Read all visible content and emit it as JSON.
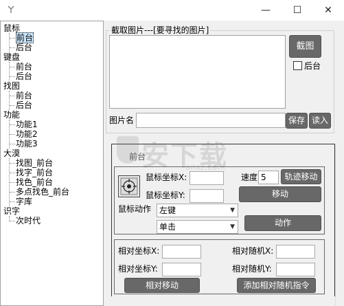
{
  "titlebar": {
    "minimize_glyph": "—",
    "maximize_glyph": "☐",
    "close_glyph": "✕"
  },
  "tree": {
    "groups": [
      {
        "label": "鼠标",
        "children": [
          "前台",
          "后台"
        ]
      },
      {
        "label": "键盘",
        "children": [
          "前台",
          "后台"
        ]
      },
      {
        "label": "找图",
        "children": [
          "前台",
          "后台"
        ]
      },
      {
        "label": "功能",
        "children": [
          "功能1",
          "功能2",
          "功能3"
        ]
      },
      {
        "label": "大漠",
        "children": [
          "找图_前台",
          "找字_前台",
          "找色_前台",
          "多点找色_前台",
          "字库"
        ]
      },
      {
        "label": "识字",
        "children": [
          "次时代"
        ]
      }
    ],
    "selected": "前台"
  },
  "capture": {
    "group_title": "截取图片---[要寻找的图片]",
    "capture_button": "截图",
    "background_checkbox_label": "后台",
    "background_checked": false,
    "image_name_label": "图片名",
    "image_name_value": "",
    "save_button": "保存",
    "load_button": "读入"
  },
  "panel": {
    "tab_label": "前台",
    "mouse_coord_label": "鼠标坐标X:",
    "mouse_coord_x": "",
    "mouse_coord_y_label": "鼠标坐标Y:",
    "mouse_coord_y": "",
    "speed_label": "速度",
    "speed_value": "5",
    "track_move_button": "轨迹移动",
    "move_button": "移动",
    "mouse_action_label": "鼠标动作",
    "button_select": "左键",
    "click_select": "单击",
    "action_button": "动作",
    "rel_x_label": "相对坐标X:",
    "rel_x_value": "",
    "rel_y_label": "相对坐标Y:",
    "rel_y_value": "",
    "rand_x_label": "相对随机X:",
    "rand_x_value": "",
    "rand_y_label": "相对随机Y:",
    "rand_y_value": "",
    "rel_move_button": "相对移动",
    "add_rel_rand_button": "添加相对随机指令"
  },
  "watermark": {
    "text": "安下载",
    "sub": "anxz.com"
  }
}
